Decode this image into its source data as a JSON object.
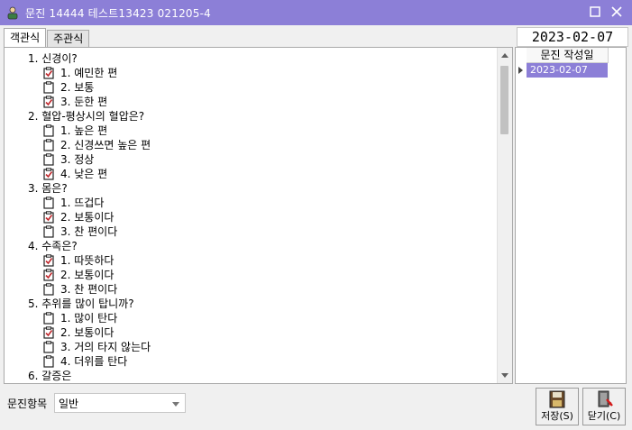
{
  "window": {
    "title": "문진 14444 테스트13423 021205-4"
  },
  "tabs": [
    {
      "label": "객관식"
    },
    {
      "label": "주관식"
    }
  ],
  "current_date": "2023-02-07",
  "questions": [
    {
      "title": "1. 신경이?",
      "options": [
        {
          "label": "1. 예민한 편",
          "checked": true
        },
        {
          "label": "2. 보통",
          "checked": false
        },
        {
          "label": "3. 둔한 편",
          "checked": true
        }
      ]
    },
    {
      "title": "2. 혈압-평상시의 혈압은?",
      "options": [
        {
          "label": "1. 높은 편",
          "checked": false
        },
        {
          "label": "2. 신경쓰면 높은 편",
          "checked": false
        },
        {
          "label": "3. 정상",
          "checked": false
        },
        {
          "label": "4. 낮은 편",
          "checked": true
        }
      ]
    },
    {
      "title": "3. 몸은?",
      "options": [
        {
          "label": "1. 뜨겁다",
          "checked": false
        },
        {
          "label": "2. 보통이다",
          "checked": true
        },
        {
          "label": "3. 찬 편이다",
          "checked": false
        }
      ]
    },
    {
      "title": "4. 수족은?",
      "options": [
        {
          "label": "1. 따뜻하다",
          "checked": true
        },
        {
          "label": "2. 보통이다",
          "checked": true
        },
        {
          "label": "3. 찬 편이다",
          "checked": false
        }
      ]
    },
    {
      "title": "5. 추위를 많이 탑니까?",
      "options": [
        {
          "label": "1. 많이 탄다",
          "checked": false
        },
        {
          "label": "2. 보통이다",
          "checked": true
        },
        {
          "label": "3. 거의 타지 않는다",
          "checked": false
        },
        {
          "label": "4. 더위를 탄다",
          "checked": false
        }
      ]
    },
    {
      "title": "6. 갈증은",
      "options": []
    }
  ],
  "history": {
    "column_header": "문진 작성일",
    "rows": [
      "2023-02-07"
    ]
  },
  "bottom": {
    "category_label": "문진항목",
    "category_value": "일반"
  },
  "buttons": {
    "save_label": "저장(S)",
    "close_label": "닫기(C)"
  },
  "colors": {
    "titlebar": "#8c7fd7",
    "selection": "#8c7fd7",
    "check": "#c0282d"
  }
}
